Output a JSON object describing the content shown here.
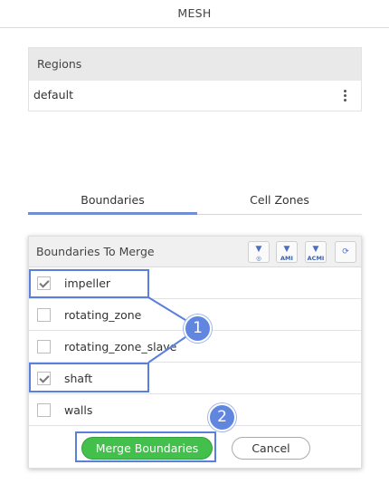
{
  "header": {
    "title": "MESH"
  },
  "regions": {
    "title": "Regions",
    "rows": [
      {
        "label": "default"
      }
    ]
  },
  "tabs": [
    {
      "label": "Boundaries",
      "active": true
    },
    {
      "label": "Cell Zones",
      "active": false
    }
  ],
  "merge_panel": {
    "title": "Boundaries To Merge",
    "toolbar": [
      {
        "icon": "patch-icon",
        "label": ""
      },
      {
        "icon": "ami-icon",
        "label": "AMI"
      },
      {
        "icon": "acmi-icon",
        "label": "ACMI"
      },
      {
        "icon": "cyclic-icon",
        "label": ""
      }
    ],
    "items": [
      {
        "label": "impeller",
        "checked": true
      },
      {
        "label": "rotating_zone",
        "checked": false
      },
      {
        "label": "rotating_zone_slave",
        "checked": false
      },
      {
        "label": "shaft",
        "checked": true
      },
      {
        "label": "walls",
        "checked": false
      }
    ],
    "merge_label": "Merge Boundaries",
    "cancel_label": "Cancel"
  },
  "annotations": [
    {
      "label": "1"
    },
    {
      "label": "2"
    }
  ],
  "colors": {
    "accent": "#6f8ed6",
    "merge": "#43c04c",
    "callout": "#5b7fdd"
  }
}
